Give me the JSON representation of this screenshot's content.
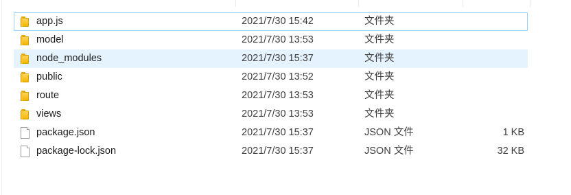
{
  "files": [
    {
      "name": "app.js",
      "date": "2021/7/30 15:42",
      "type": "文件夹",
      "size": "",
      "icon": "folder-icon",
      "state": "focused"
    },
    {
      "name": "model",
      "date": "2021/7/30 13:53",
      "type": "文件夹",
      "size": "",
      "icon": "folder-icon",
      "state": ""
    },
    {
      "name": "node_modules",
      "date": "2021/7/30 15:37",
      "type": "文件夹",
      "size": "",
      "icon": "folder-icon",
      "state": "hovered"
    },
    {
      "name": "public",
      "date": "2021/7/30 13:52",
      "type": "文件夹",
      "size": "",
      "icon": "folder-icon",
      "state": ""
    },
    {
      "name": "route",
      "date": "2021/7/30 13:53",
      "type": "文件夹",
      "size": "",
      "icon": "folder-icon",
      "state": ""
    },
    {
      "name": "views",
      "date": "2021/7/30 13:53",
      "type": "文件夹",
      "size": "",
      "icon": "folder-icon",
      "state": ""
    },
    {
      "name": "package.json",
      "date": "2021/7/30 15:37",
      "type": "JSON 文件",
      "size": "1 KB",
      "icon": "file-icon",
      "state": ""
    },
    {
      "name": "package-lock.json",
      "date": "2021/7/30 15:37",
      "type": "JSON 文件",
      "size": "32 KB",
      "icon": "file-icon",
      "state": ""
    }
  ]
}
